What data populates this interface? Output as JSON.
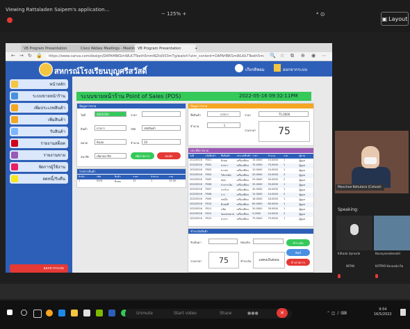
{
  "share": {
    "viewing": "Viewing Rattaladen Saipem's application...",
    "zoom": "− 125% +",
    "top_icons": "⁴ ⊙",
    "layout_label": "Layout"
  },
  "browser": {
    "tabs": [
      "VB Program Presentation",
      "Cisco Webex Meetings - Meetin",
      "VB Program Presentation",
      "+"
    ],
    "url": "https://www.canva.com/design/DAFAHBKSmWLK7Teeth5mmNZtdX03mTg/watch?utm_content=DAFAHBKSmWLKk7Teeth5mmN..."
  },
  "app": {
    "title": "สหกรณ์โรงเรียนบุญศรีสวัสดิ์",
    "user": "เกียรติ​พยม",
    "logout_top": "ออกจากระบบ",
    "page_title": "ระบบขายหน้าร้าน Point of Sales (POS)",
    "date": "2022-05-16 09:32:11PM"
  },
  "sidebar": [
    {
      "label": "หน้าหลัก",
      "color": "#f5c542"
    },
    {
      "label": "ระบบขายหน้าร้าน",
      "color": "#4a90e2"
    },
    {
      "label": "เพิ่มประเภทสินค้า",
      "color": "#f5a623"
    },
    {
      "label": "เพิ่มสินค้า",
      "color": "#f5a623"
    },
    {
      "label": "รับสินค้า",
      "color": "#7bb6ff"
    },
    {
      "label": "รายงานสต็อค",
      "color": "#d0021b"
    },
    {
      "label": "รายงานขาย",
      "color": "#9b59b6"
    },
    {
      "label": "จัดการผู้ใช้งาน",
      "color": "#e91e63"
    },
    {
      "label": "ลดหนี้/รับคืน",
      "color": "#f8e71c"
    }
  ],
  "logout_side": "ออกจากระบบ",
  "form": {
    "header": "ข้อมูลการขาย",
    "id_label": "ไอดี",
    "id_value": "0001000",
    "price_label": "ราคา",
    "product_label": "สินค้า",
    "product_value": "ปากกา",
    "code_label": "รหัส",
    "code_value": "รหัสสินค้า",
    "type_label": "หมวด",
    "type_value": "ดินสอ",
    "qty_label": "จำนวน",
    "qty_value": "10",
    "user_label": "สมาชิก",
    "user_value": "เลือกสมาชิก",
    "add_button": "เพิ่มรายการ",
    "cancel_button": "ยกเลิก"
  },
  "cart": {
    "header": "รายการสินค้า",
    "columns": [
      "ลำดับ",
      "รหัส",
      "สินค้า",
      "ราคา",
      "จำนวน",
      "รวม"
    ],
    "row": [
      "1",
      "0001",
      "ดินสอ",
      "15",
      "1",
      "15.00"
    ]
  },
  "summary": {
    "header": "ข้อมูลการขาย",
    "product_label": "ชื่อสินค้า",
    "product_value": "ปากกา",
    "price_label": "ราคา",
    "price_value": "75.0000",
    "qty_label": "จำนวน",
    "qty_value": "1",
    "total_label": "รวมราคา",
    "total_value": "75"
  },
  "history": {
    "header": "ประวัติการขาย",
    "columns": [
      "ไอดี",
      "รหัสสินค้า",
      "ชื่อสินค้า",
      "ประเภทสินค้า",
      "ราคา",
      "จำนวน",
      "รวม",
      "ผู้ขาย"
    ],
    "rows": [
      [
        "20220516",
        "P001",
        "ดินสอ",
        "เครื่องเขียน",
        "15.0000",
        "15.0000",
        "1",
        "ผู้ดูแล"
      ],
      [
        "20220516",
        "P002",
        "ปากกา",
        "เครื่องเขียน",
        "75.0000",
        "75.0000",
        "1",
        "ผู้ดูแล"
      ],
      [
        "20220516",
        "P003",
        "ยางลบ",
        "เครื่องเขียน",
        "10.0000",
        "10.0000",
        "1",
        "ผู้ดูแล"
      ],
      [
        "20220516",
        "P004",
        "ไม้บรรทัด",
        "เครื่องเขียน",
        "20.0000",
        "20.0000",
        "2",
        "ผู้ดูแล"
      ],
      [
        "20220516",
        "P005",
        "สมุด",
        "เครื่องเขียน",
        "25.0000",
        "50.0000",
        "2",
        "ผู้ดูแล"
      ],
      [
        "20220516",
        "P006",
        "ปากกาเน้น",
        "เครื่องเขียน",
        "35.0000",
        "35.0000",
        "1",
        "ผู้ดูแล"
      ],
      [
        "20220516",
        "P007",
        "กรรไกร",
        "เครื่องเขียน",
        "40.0000",
        "40.0000",
        "1",
        "ผู้ดูแล"
      ],
      [
        "20220516",
        "P008",
        "กาว",
        "เครื่องเขียน",
        "12.0000",
        "24.0000",
        "2",
        "ผู้ดูแล"
      ],
      [
        "20220516",
        "P009",
        "เทปใส",
        "เครื่องเขียน",
        "18.0000",
        "18.0000",
        "1",
        "ผู้ดูแล"
      ],
      [
        "20220516",
        "P010",
        "ดินสอสี",
        "เครื่องเขียน",
        "60.0000",
        "60.0000",
        "1",
        "ผู้ดูแล"
      ],
      [
        "20220516",
        "P011",
        "แฟ้ม",
        "เครื่องเขียน",
        "30.0000",
        "30.0000",
        "1",
        "ผู้ดูแล"
      ],
      [
        "20220516",
        "P012",
        "ซองจดหมาย",
        "เครื่องเขียน",
        "5.0000",
        "10.0000",
        "2",
        "ผู้ดูแล"
      ],
      [
        "20220516",
        "P013",
        "ปากกา",
        "เครื่องเขียน",
        "75.0000",
        "75.0000",
        "1",
        "ผู้ดูแล"
      ]
    ]
  },
  "payment": {
    "header": "ชำระเงินสินค้า",
    "cash_label": "รับเงินมา",
    "change_label": "ทอนเงิน",
    "total_label": "รวมราคา",
    "total_value": "75",
    "pay_label": "ชำระเงิน",
    "pay_value": "แสดงเงินทอน",
    "btn_pay": "ชำระเงิน",
    "btn_print": "พิมพ์",
    "btn_clear": "ล้างรายการ"
  },
  "participants": {
    "video_name": "Manchee Kehutara (Cohost)",
    "speaking": "Speaking:",
    "tiles": [
      {
        "name": "Kittada Uprasda",
        "sub": "NITAN"
      },
      {
        "name": "Boonyaendeesatri",
        "sub": "KATPAR Kanoada Ra"
      }
    ]
  },
  "taskbar": {
    "call_items": [
      "Unmute",
      "Start video",
      "Share",
      "●●●",
      "✕"
    ],
    "time": "9:54",
    "date": "16/5/2022"
  }
}
